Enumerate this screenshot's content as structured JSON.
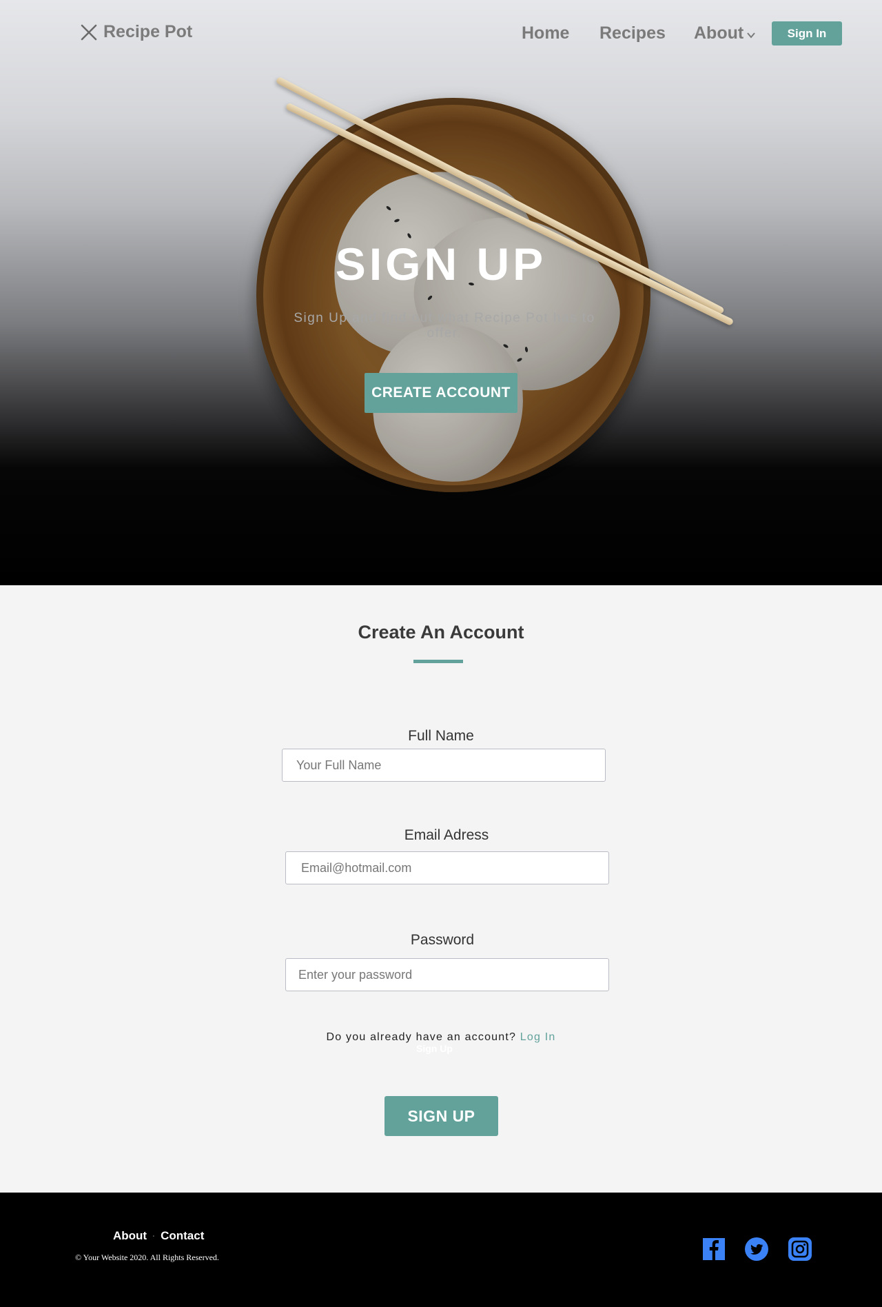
{
  "nav": {
    "logo_text": "Recipe Pot",
    "home_label": "Home",
    "recipes_label": "Recipes",
    "about_label": "About",
    "signin_label": "Sign In"
  },
  "hero": {
    "title": "SIGN UP",
    "subtitle": "Sign Up and find out what Recipe Pot has to offer.",
    "cta_label": "CREATE ACCOUNT"
  },
  "form": {
    "title": "Create An Account",
    "full_name": {
      "label": "Full Name",
      "placeholder": "Your Full Name"
    },
    "email": {
      "label": "Email Adress",
      "placeholder": "Email@hotmail.com"
    },
    "password": {
      "label": "Password",
      "placeholder": "Enter your password"
    },
    "already_text": "Do you already have an account?",
    "login_label": "Log In",
    "ghost_text": "Sign Up",
    "submit_label": "SIGN UP"
  },
  "footer": {
    "about_label": "About",
    "contact_label": "Contact",
    "copyright": "© Your Website 2020. All Rights Reserved.",
    "social": [
      "facebook-icon",
      "twitter-icon",
      "instagram-icon"
    ]
  },
  "colors": {
    "accent": "#62a29b",
    "social_blue": "#3b82f6",
    "footer_bg": "#000000",
    "page_bg": "#f4f4f4"
  }
}
